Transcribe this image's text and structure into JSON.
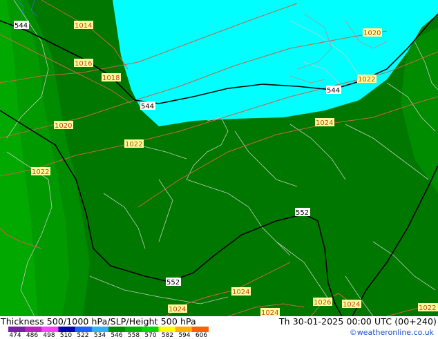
{
  "footer": {
    "title": "Thickness 500/1000 hPa/SLP/Height 500 hPa",
    "valid_time": "Th 30-01-2025 00:00 UTC (00+240)",
    "credit": "©weatheronline.co.uk"
  },
  "legend": {
    "values": [
      "474",
      "486",
      "498",
      "510",
      "522",
      "534",
      "546",
      "558",
      "570",
      "582",
      "594",
      "606"
    ],
    "colors": [
      "#7a1fa0",
      "#c020c0",
      "#ff40ff",
      "#0000b0",
      "#1e60ff",
      "#30b0ff",
      "#008c00",
      "#00b400",
      "#00d800",
      "#ffff00",
      "#ffb000",
      "#ff6000"
    ]
  },
  "map": {
    "colors": {
      "ocean_cyan": "#00ffff",
      "land_dark_green": "#007800",
      "land_mid_green": "#008c00",
      "land_light_green": "#00a800",
      "isobar": "#c86446",
      "height_contour": "#000000",
      "border": "#c8c8c8"
    },
    "height_labels": [
      "544",
      "544",
      "544",
      "552",
      "552"
    ],
    "isobar_labels": [
      "1014",
      "1016",
      "1018",
      "1020",
      "1022",
      "1022",
      "1020",
      "1022",
      "1024",
      "1024",
      "1024",
      "1024",
      "1026",
      "1024",
      "1022"
    ]
  }
}
